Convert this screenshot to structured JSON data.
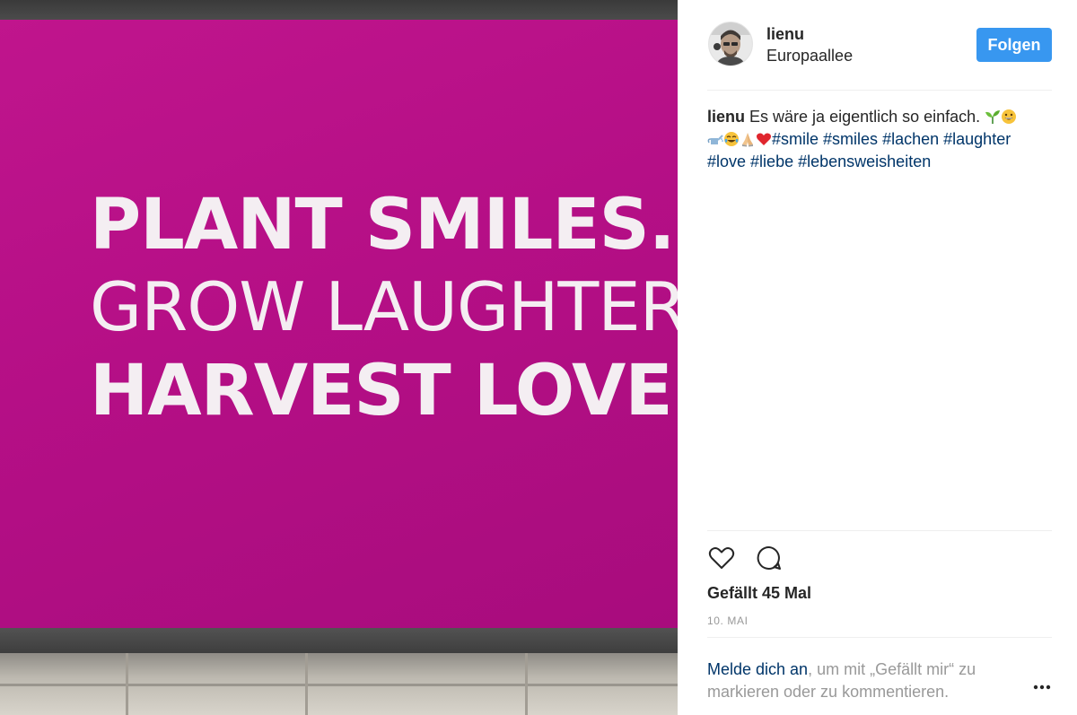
{
  "photo": {
    "slogan_line1": "PLANT SMILES.",
    "slogan_line2": "GROW LAUGHTER.",
    "slogan_line3": "HARVEST LOVE.",
    "billboard_color": "#b8128a"
  },
  "header": {
    "username": "lienu",
    "location": "Europaallee",
    "follow_label": "Folgen"
  },
  "caption": {
    "username": "lienu",
    "text": "Es wäre ja eigentlich so einfach.",
    "hashtags": [
      "#smile",
      "#smiles",
      "#lachen",
      "#laughter",
      "#love",
      "#liebe",
      "#lebensweisheiten"
    ],
    "emojis_line1": [
      "seedling-emoji",
      "grinning-face-emoji"
    ],
    "emojis_line2": [
      "watering-can-emoji",
      "tears-of-joy-emoji",
      "folded-hands-emoji",
      "red-heart-emoji"
    ]
  },
  "actions": {
    "like_icon": "heart-outline-icon",
    "comment_icon": "comment-bubble-icon",
    "more_icon": "ellipsis-icon"
  },
  "stats": {
    "likes": "Gefällt 45 Mal",
    "date": "10. MAI"
  },
  "login": {
    "link_text": "Melde dich an",
    "rest_text": ", um mit „Gefällt mir“ zu markieren oder zu kommentieren."
  },
  "colors": {
    "accent": "#3897f0",
    "link": "#003569",
    "muted": "#999999",
    "text": "#262626"
  }
}
